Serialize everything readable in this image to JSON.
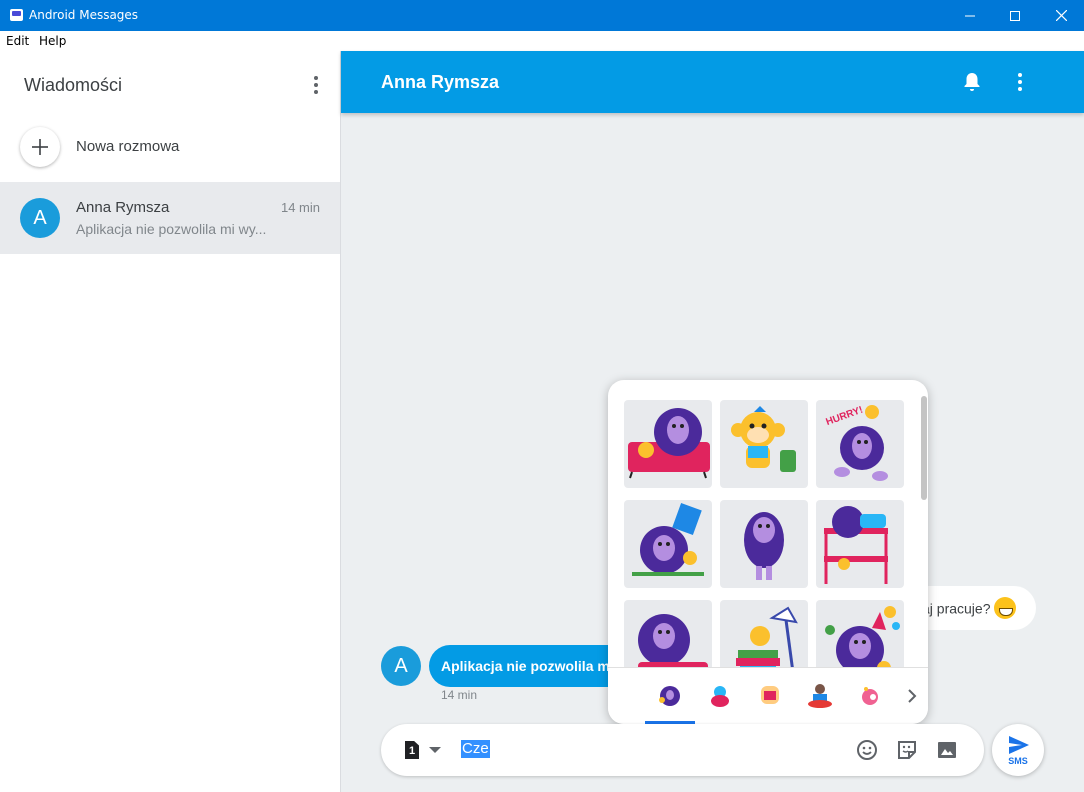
{
  "window": {
    "title": "Android Messages",
    "menu": [
      "Edit",
      "Help"
    ]
  },
  "sidebar": {
    "title": "Wiadomości",
    "new_conversation": "Nowa rozmowa",
    "conversations": [
      {
        "avatar_letter": "A",
        "name": "Anna Rymsza",
        "time": "14 min",
        "snippet": "Aplikacja nie pozwolila mi wy..."
      }
    ]
  },
  "header": {
    "contact_name": "Anna Rymsza"
  },
  "messages": {
    "incoming": {
      "avatar_letter": "A",
      "text": "Aplikacja nie pozwolila mi",
      "time": "14 min"
    },
    "outgoing": {
      "text": "aj pracuje?"
    }
  },
  "sticker_panel": {
    "tabs": [
      "tab-1",
      "tab-2",
      "tab-3",
      "tab-4",
      "tab-5"
    ],
    "active_tab": 0
  },
  "compose": {
    "sim_number": "1",
    "input_value": "Cze",
    "send_label": "SMS"
  },
  "colors": {
    "titlebar": "#0078d7",
    "header": "#039be5",
    "avatar": "#1a9cdb",
    "accent": "#1a73e8"
  }
}
